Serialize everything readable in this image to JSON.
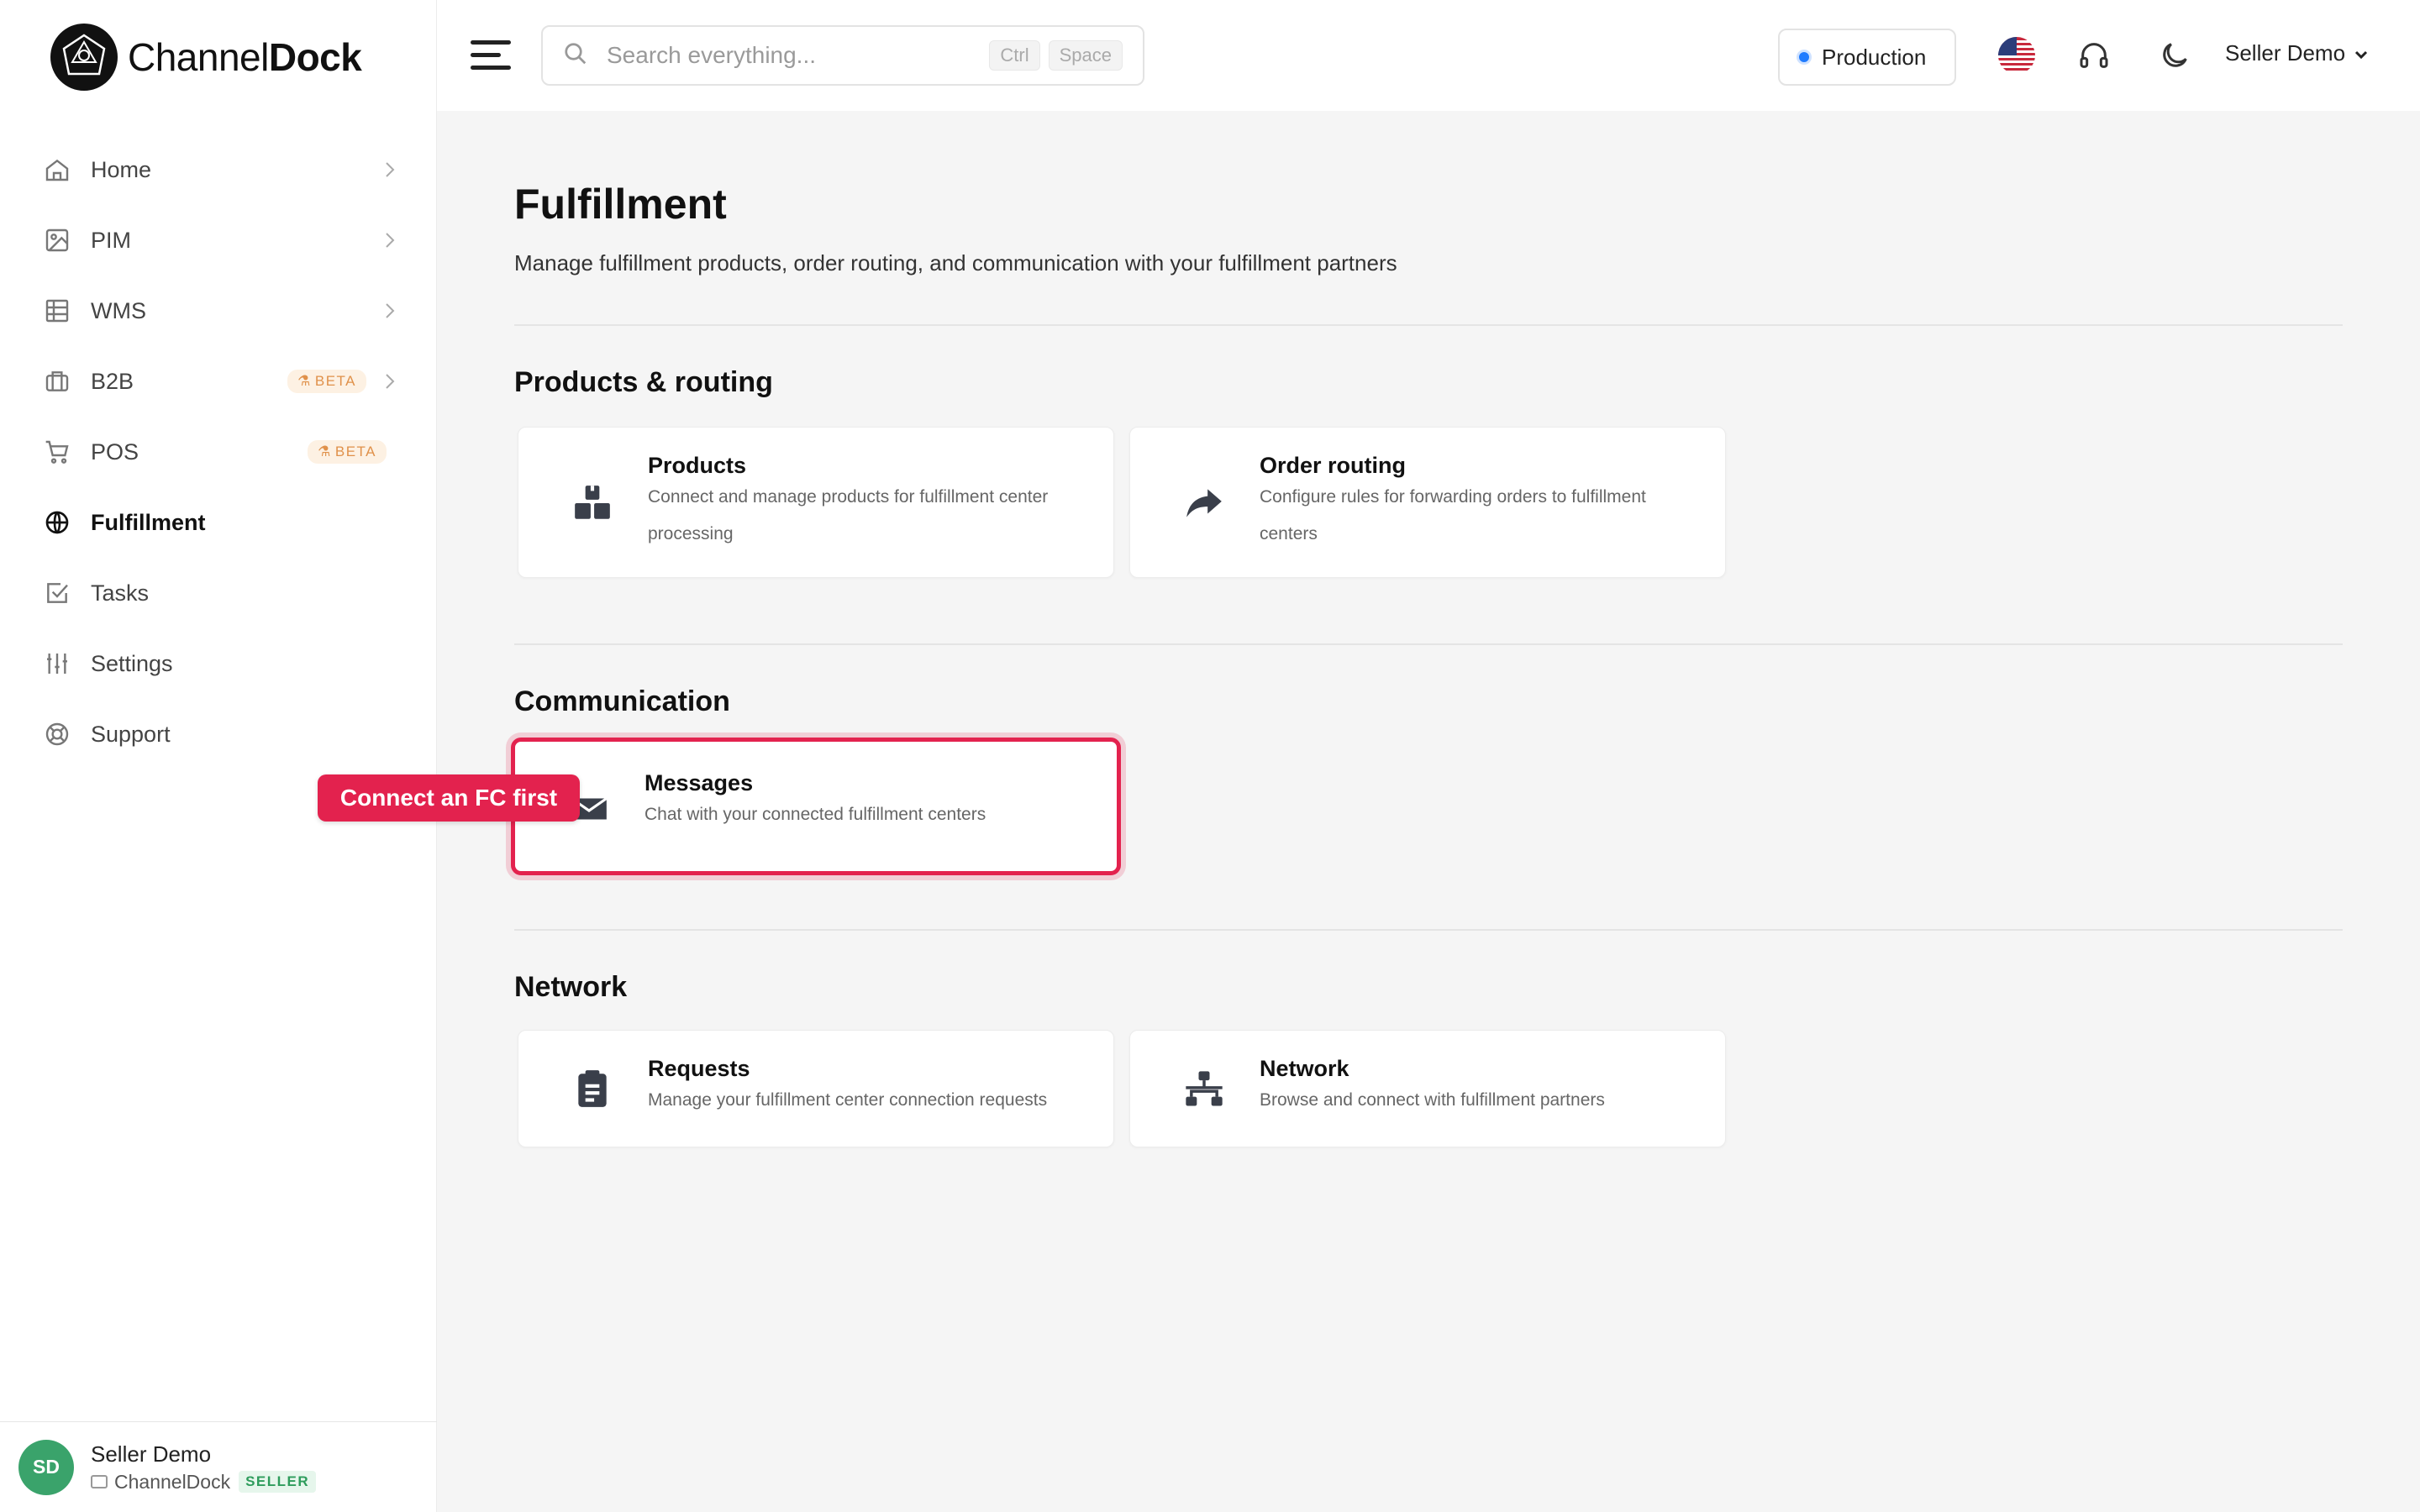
{
  "app": {
    "logo_name_light": "Channel",
    "logo_name_bold": "Dock"
  },
  "search": {
    "placeholder": "Search everything...",
    "kbd1": "Ctrl",
    "kbd2": "Space"
  },
  "header": {
    "environment": "Production",
    "user_menu": "Seller Demo"
  },
  "sidebar": {
    "items": [
      {
        "label": "Home"
      },
      {
        "label": "PIM"
      },
      {
        "label": "WMS"
      },
      {
        "label": "B2B",
        "badge": "BETA"
      },
      {
        "label": "POS",
        "badge": "BETA"
      },
      {
        "label": "Fulfillment"
      },
      {
        "label": "Tasks"
      },
      {
        "label": "Settings"
      },
      {
        "label": "Support"
      }
    ],
    "user": {
      "initials": "SD",
      "name": "Seller Demo",
      "org": "ChannelDock",
      "role": "SELLER"
    }
  },
  "page": {
    "title": "Fulfillment",
    "subtitle": "Manage fulfillment products, order routing, and communication with your fulfillment partners"
  },
  "sections": [
    {
      "title": "Products & routing",
      "cards": [
        {
          "title": "Products",
          "desc": "Connect and manage products for fulfillment center processing",
          "icon": "boxes-icon"
        },
        {
          "title": "Order routing",
          "desc": "Configure rules for forwarding orders to fulfillment centers",
          "icon": "share-arrow-icon"
        }
      ]
    },
    {
      "title": "Communication",
      "cards": [
        {
          "title": "Messages",
          "desc": "Chat with your connected fulfillment centers",
          "icon": "envelope-icon"
        }
      ]
    },
    {
      "title": "Network",
      "cards": [
        {
          "title": "Requests",
          "desc": "Manage your fulfillment center connection requests",
          "icon": "clipboard-list-icon"
        },
        {
          "title": "Network",
          "desc": "Browse and connect with fulfillment partners",
          "icon": "network-icon"
        }
      ]
    }
  ],
  "tooltip": {
    "text": "Connect an FC first"
  },
  "colors": {
    "accent_red": "#e3224e",
    "beta": "#e0914a",
    "seller_green": "#2e9c5c",
    "env_dot": "#1f7bff"
  }
}
